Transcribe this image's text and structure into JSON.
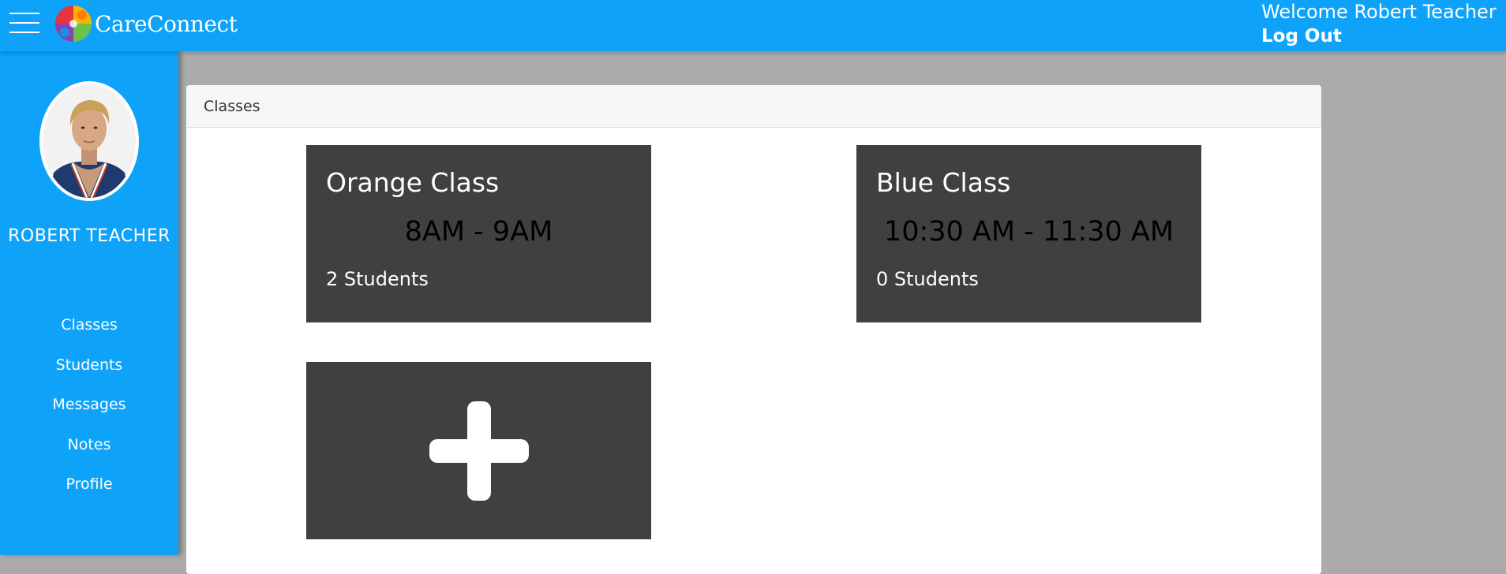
{
  "header": {
    "app_name": "CareConnect",
    "welcome_text": "Welcome Robert Teacher",
    "logout_label": "Log Out",
    "brand_color": "#0ea3f8"
  },
  "sidebar": {
    "user_name": "ROBERT TEACHER",
    "items": [
      {
        "label": "Classes"
      },
      {
        "label": "Students"
      },
      {
        "label": "Messages"
      },
      {
        "label": "Notes"
      },
      {
        "label": "Profile"
      }
    ]
  },
  "main": {
    "panel_title": "Classes",
    "classes": [
      {
        "name": "Orange Class",
        "time": "8AM - 9AM",
        "students": "2 Students"
      },
      {
        "name": "Blue Class",
        "time": "10:30 AM - 11:30 AM",
        "students": "0 Students"
      }
    ],
    "add_card_icon": "plus-icon",
    "card_color": "#404040"
  }
}
